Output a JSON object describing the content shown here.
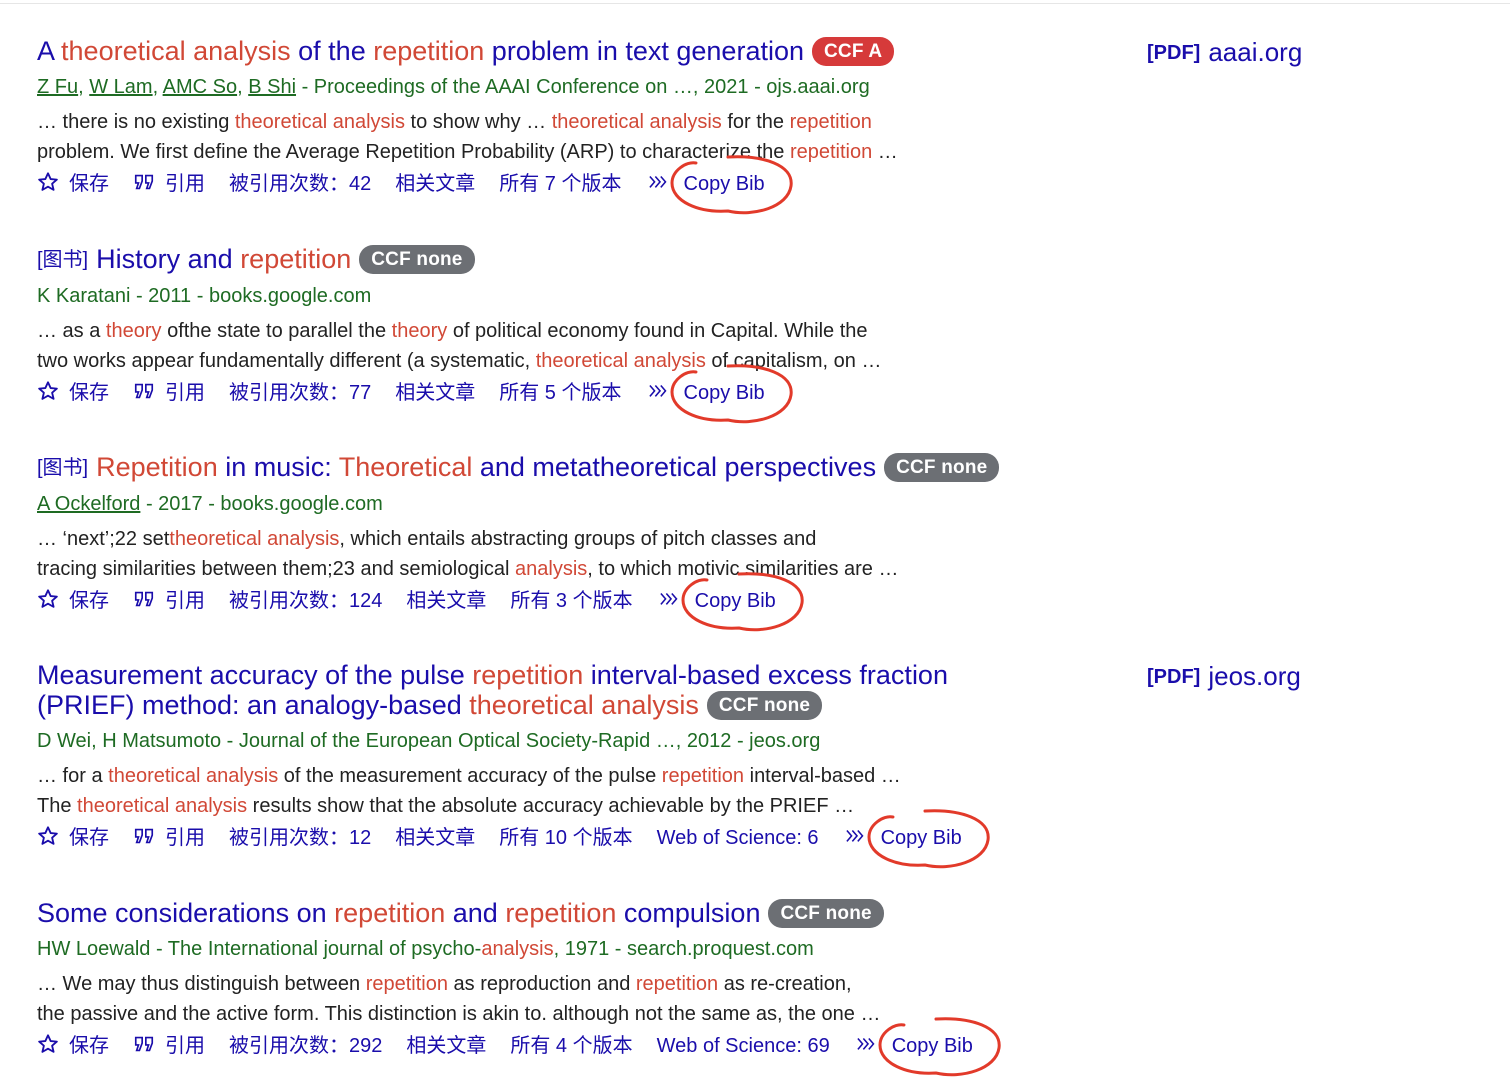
{
  "results": [
    {
      "title_parts": [
        {
          "t": "A ",
          "hl": false
        },
        {
          "t": "theoretical analysis",
          "hl": true
        },
        {
          "t": " of the ",
          "hl": false
        },
        {
          "t": "repetition",
          "hl": true
        },
        {
          "t": " problem in text generation",
          "hl": false
        }
      ],
      "badge": "CCF A",
      "badge_kind": "a",
      "authors_linked": [
        "Z Fu",
        "W Lam",
        "AMC So",
        "B Shi"
      ],
      "source": " - Proceedings of the AAAI Conference on …, 2021 - ojs.aaai.org",
      "snippet_lines": [
        [
          {
            "t": "… there is no existing ",
            "hl": false
          },
          {
            "t": "theoretical analysis",
            "hl": true
          },
          {
            "t": " to show why … ",
            "hl": false
          },
          {
            "t": "theoretical analysis",
            "hl": true
          },
          {
            "t": " for the ",
            "hl": false
          },
          {
            "t": "repetition",
            "hl": true
          }
        ],
        [
          {
            "t": "problem. We first define the Average Repetition Probability (ARP) to characterize the ",
            "hl": false
          },
          {
            "t": "repetition",
            "hl": true
          },
          {
            "t": " …",
            "hl": false
          }
        ]
      ],
      "save": "保存",
      "cite": "引用",
      "cited_by": "被引用次数：42",
      "related": "相关文章",
      "versions": "所有 7 个版本",
      "copy_bib": "Copy Bib",
      "side_pdf": "[PDF]",
      "side_domain": "aaai.org"
    },
    {
      "tag": "[图书]",
      "title_parts": [
        {
          "t": "History and ",
          "hl": false
        },
        {
          "t": "repetition",
          "hl": true
        }
      ],
      "badge": "CCF none",
      "badge_kind": "none",
      "authors_plain": "K Karatani",
      "source": " - 2011 - books.google.com",
      "snippet_lines": [
        [
          {
            "t": "… as a ",
            "hl": false
          },
          {
            "t": "theory",
            "hl": true
          },
          {
            "t": " ofthe state to parallel the ",
            "hl": false
          },
          {
            "t": "theory",
            "hl": true
          },
          {
            "t": " of political economy found in Capital. While the",
            "hl": false
          }
        ],
        [
          {
            "t": "two works appear fundamentally different (a systematic, ",
            "hl": false
          },
          {
            "t": "theoretical analysis",
            "hl": true
          },
          {
            "t": " of capitalism, on …",
            "hl": false
          }
        ]
      ],
      "save": "保存",
      "cite": "引用",
      "cited_by": "被引用次数：77",
      "related": "相关文章",
      "versions": "所有 5 个版本",
      "copy_bib": "Copy Bib"
    },
    {
      "tag": "[图书]",
      "title_parts": [
        {
          "t": "Repetition",
          "hl": true
        },
        {
          "t": " in music: ",
          "hl": false
        },
        {
          "t": "Theoretical",
          "hl": true
        },
        {
          "t": " and metatheoretical perspectives",
          "hl": false
        }
      ],
      "badge": "CCF none",
      "badge_kind": "none",
      "authors_linked": [
        "A Ockelford"
      ],
      "source": " - 2017 - books.google.com",
      "snippet_lines": [
        [
          {
            "t": "… ‘next’;22 set",
            "hl": false
          },
          {
            "t": "theoretical analysis",
            "hl": true
          },
          {
            "t": ", which entails abstracting groups of pitch classes and",
            "hl": false
          }
        ],
        [
          {
            "t": "tracing similarities between them;23 and semiological ",
            "hl": false
          },
          {
            "t": "analysis",
            "hl": true
          },
          {
            "t": ", to which motivic similarities are …",
            "hl": false
          }
        ]
      ],
      "save": "保存",
      "cite": "引用",
      "cited_by": "被引用次数：124",
      "related": "相关文章",
      "versions": "所有 3 个版本",
      "copy_bib": "Copy Bib"
    },
    {
      "title_parts": [
        {
          "t": "Measurement accuracy of the pulse ",
          "hl": false
        },
        {
          "t": "repetition",
          "hl": true
        },
        {
          "t": " interval-based excess fraction (PRIEF) method: an analogy-based ",
          "hl": false
        },
        {
          "t": "theoretical analysis",
          "hl": true
        }
      ],
      "badge": "CCF none",
      "badge_kind": "none",
      "authors_plain": "D Wei, H Matsumoto",
      "source": " - Journal of the European Optical Society-Rapid …, 2012 - jeos.org",
      "snippet_lines": [
        [
          {
            "t": "… for a ",
            "hl": false
          },
          {
            "t": "theoretical analysis",
            "hl": true
          },
          {
            "t": " of the measurement accuracy of the pulse ",
            "hl": false
          },
          {
            "t": "repetition",
            "hl": true
          },
          {
            "t": " interval-based …",
            "hl": false
          }
        ],
        [
          {
            "t": "The ",
            "hl": false
          },
          {
            "t": "theoretical analysis",
            "hl": true
          },
          {
            "t": " results show that the absolute accuracy achievable by the PRIEF …",
            "hl": false
          }
        ]
      ],
      "save": "保存",
      "cite": "引用",
      "cited_by": "被引用次数：12",
      "related": "相关文章",
      "versions": "所有 10 个版本",
      "wos": "Web of Science: 6",
      "copy_bib": "Copy Bib",
      "side_pdf": "[PDF]",
      "side_domain": "jeos.org"
    },
    {
      "title_parts": [
        {
          "t": "Some considerations on ",
          "hl": false
        },
        {
          "t": "repetition",
          "hl": true
        },
        {
          "t": " and ",
          "hl": false
        },
        {
          "t": "repetition",
          "hl": true
        },
        {
          "t": " compulsion",
          "hl": false
        }
      ],
      "badge": "CCF none",
      "badge_kind": "none",
      "authors_plain": "HW Loewald",
      "source_parts": [
        {
          "t": " - The International journal of psycho-",
          "hl": false
        },
        {
          "t": "analysis",
          "hl": true
        },
        {
          "t": ", 1971 - search.proquest.com",
          "hl": false
        }
      ],
      "snippet_lines": [
        [
          {
            "t": "… We may thus distinguish between ",
            "hl": false
          },
          {
            "t": "repetition",
            "hl": true
          },
          {
            "t": " as reproduction and ",
            "hl": false
          },
          {
            "t": "repetition",
            "hl": true
          },
          {
            "t": " as re-creation,",
            "hl": false
          }
        ],
        [
          {
            "t": "the passive and the active form. This distinction is akin to. although not the same as, the one …",
            "hl": false
          }
        ]
      ],
      "save": "保存",
      "cite": "引用",
      "cited_by": "被引用次数：292",
      "related": "相关文章",
      "versions": "所有 4 个版本",
      "wos": "Web of Science: 69",
      "copy_bib": "Copy Bib"
    }
  ],
  "icons": {
    "save": "star-outline-icon",
    "cite": "quote-icon",
    "more": "double-chevron-icon"
  },
  "colors": {
    "link": "#1a0dab",
    "highlight": "#d14836",
    "source_green": "#1e6b23",
    "annotation_red": "#e23a2a",
    "badge_red": "#d63a3a",
    "badge_gray": "#6c6f74"
  }
}
